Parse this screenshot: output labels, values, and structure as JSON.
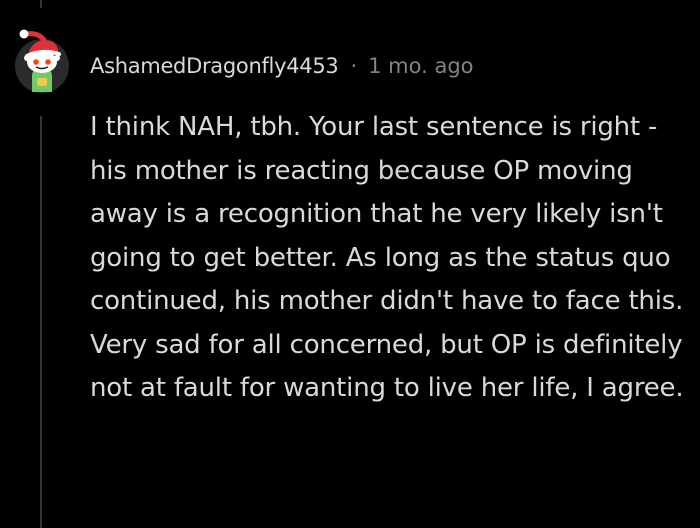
{
  "comment": {
    "author": "AshamedDragonfly4453",
    "separator": "·",
    "timestamp": "1 mo. ago",
    "avatar_icon": "snoo-avatar-santa-hat-icon",
    "body": "I think NAH, tbh. Your last sentence is right - his mother is reacting because OP moving away is a recognition that he very likely isn't going to get better. As long as the status quo continued, his mother didn't have to face this. Very sad for all concerned, but OP is definitely not at fault for wanting to live her life, I agree."
  },
  "colors": {
    "background": "#000000",
    "text_primary": "#d7dadc",
    "text_secondary": "#818384",
    "thread_line": "#343536",
    "hat_red": "#e0313b",
    "snoo_green": "#73c966"
  }
}
